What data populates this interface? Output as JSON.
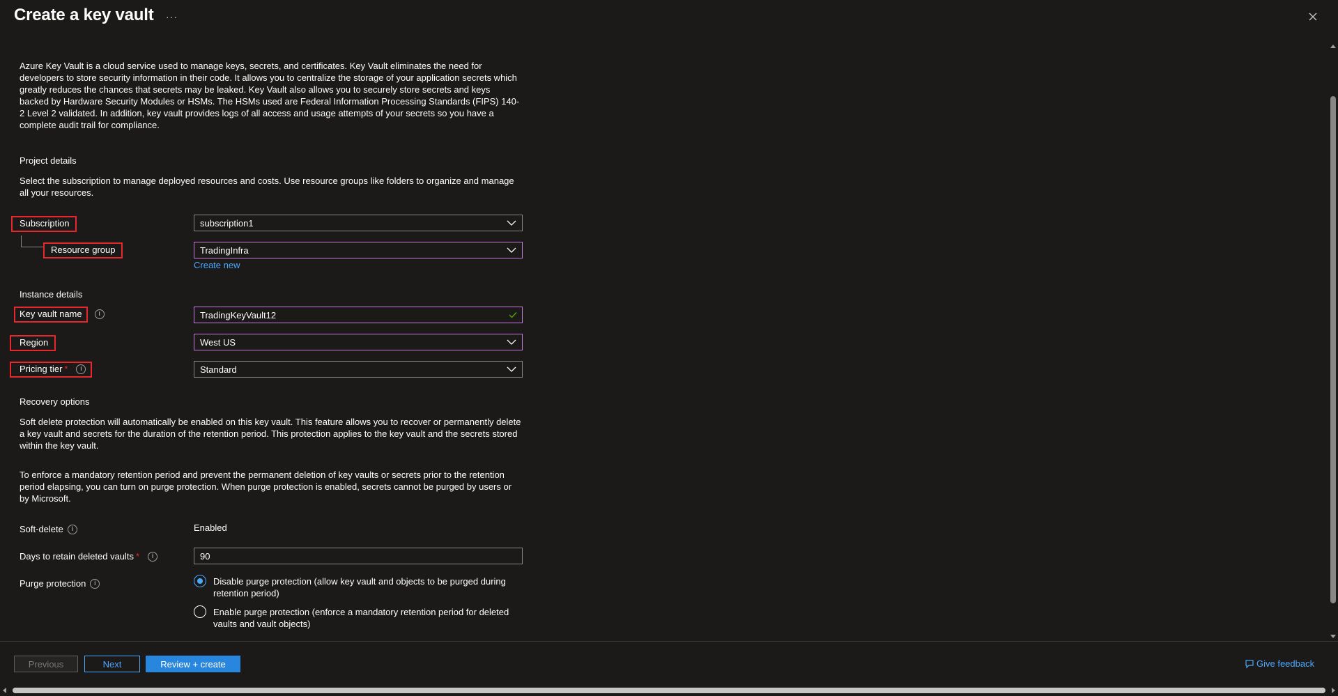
{
  "header": {
    "title": "Create a key vault",
    "more_label": "···"
  },
  "intro": "Azure Key Vault is a cloud service used to manage keys, secrets, and certificates. Key Vault eliminates the need for developers to store security information in their code. It allows you to centralize the storage of your application secrets which greatly reduces the chances that secrets may be leaked. Key Vault also allows you to securely store secrets and keys backed by Hardware Security Modules or HSMs. The HSMs used are Federal Information Processing Standards (FIPS) 140-2 Level 2 validated. In addition, key vault provides logs of all access and usage attempts of your secrets so you have a complete audit trail for compliance.",
  "project": {
    "title": "Project details",
    "description": "Select the subscription to manage deployed resources and costs. Use resource groups like folders to organize and manage all your resources.",
    "subscription_label": "Subscription",
    "subscription_value": "subscription1",
    "resource_group_label": "Resource group",
    "resource_group_value": "TradingInfra",
    "create_new": "Create new"
  },
  "instance": {
    "title": "Instance details",
    "name_label": "Key vault name",
    "name_value": "TradingKeyVault12",
    "region_label": "Region",
    "region_value": "West US",
    "tier_label": "Pricing tier",
    "tier_required": "*",
    "tier_value": "Standard"
  },
  "recovery": {
    "title": "Recovery options",
    "para1": "Soft delete protection will automatically be enabled on this key vault. This feature allows you to recover or permanently delete a key vault and secrets for the duration of the retention period. This protection applies to the key vault and the secrets stored within the key vault.",
    "para2": "To enforce a mandatory retention period and prevent the permanent deletion of key vaults or secrets prior to the retention period elapsing, you can turn on purge protection. When purge protection is enabled, secrets cannot be purged by users or by Microsoft.",
    "soft_delete_label": "Soft-delete",
    "soft_delete_value": "Enabled",
    "days_label": "Days to retain deleted vaults",
    "days_required": "*",
    "days_value": "90",
    "purge_label": "Purge protection",
    "purge_option1": "Disable purge protection (allow key vault and objects to be purged during retention period)",
    "purge_option2": "Enable purge protection (enforce a mandatory retention period for deleted vaults and vault objects)",
    "purge_selected": 0
  },
  "footer": {
    "previous": "Previous",
    "next": "Next",
    "review": "Review + create",
    "feedback": "Give feedback"
  },
  "colors": {
    "background": "#1b1a19",
    "accent": "#4aa8ff",
    "primary_button": "#2886de",
    "highlight_box": "#e8272d",
    "focus_border": "#c67ddf",
    "valid_check": "#57a300"
  },
  "icons": {
    "more": "more-icon",
    "close": "close-icon",
    "chevron": "chevron-down-icon",
    "check": "checkmark-icon",
    "info": "info-icon",
    "feedback": "feedback-icon"
  }
}
